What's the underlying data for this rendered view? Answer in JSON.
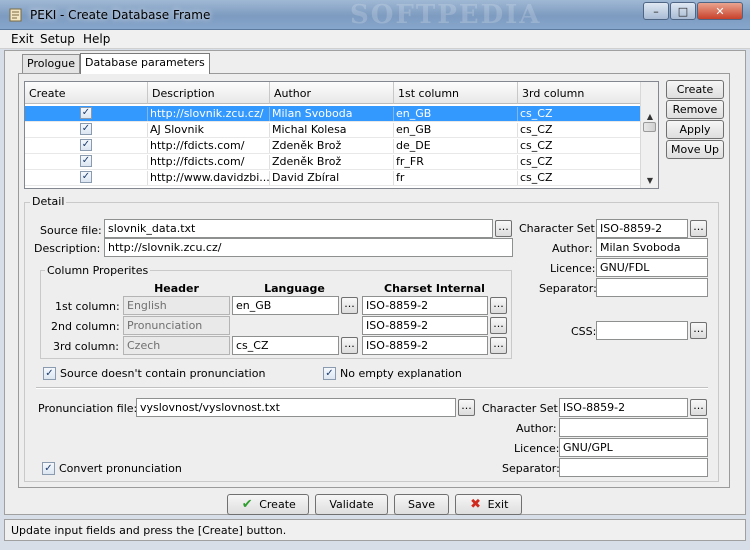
{
  "window": {
    "title": "PEKI - Create Database Frame",
    "watermark": "SOFTPEDIA",
    "minimize_symbol": "–",
    "maximize_symbol": "□",
    "close_symbol": "✕"
  },
  "menu": {
    "items": [
      "Exit",
      "Setup",
      "Help"
    ]
  },
  "tabs": [
    {
      "label": "Prologue",
      "active": false
    },
    {
      "label": "Database parameters",
      "active": true
    }
  ],
  "table": {
    "headers": [
      "Create",
      "Description",
      "Author",
      "1st column",
      "3rd column"
    ],
    "rows": [
      {
        "create": true,
        "description": "http://slovnik.zcu.cz/",
        "author": "Milan Svoboda",
        "col1": "en_GB",
        "col3": "cs_CZ",
        "selected": true
      },
      {
        "create": true,
        "description": "AJ Slovnik",
        "author": "Michal Kolesa",
        "col1": "en_GB",
        "col3": "cs_CZ",
        "selected": false
      },
      {
        "create": true,
        "description": "http://fdicts.com/",
        "author": "Zdeněk Brož",
        "col1": "de_DE",
        "col3": "cs_CZ",
        "selected": false
      },
      {
        "create": true,
        "description": "http://fdicts.com/",
        "author": "Zdeněk Brož",
        "col1": "fr_FR",
        "col3": "cs_CZ",
        "selected": false
      },
      {
        "create": true,
        "description": "http://www.davidzbi...",
        "author": "David Zbíral",
        "col1": "fr",
        "col3": "cs_CZ",
        "selected": false
      }
    ],
    "check_mark": "✓"
  },
  "side_buttons": {
    "create": "Create",
    "remove": "Remove",
    "apply": "Apply",
    "move_up": "Move Up"
  },
  "detail": {
    "legend": "Detail",
    "source_file_label": "Source file:",
    "source_file_value": "slovnik_data.txt",
    "description_label": "Description:",
    "description_value": "http://slovnik.zcu.cz/",
    "charset_label": "Character Set:",
    "charset_value": "ISO-8859-2",
    "author_label": "Author:",
    "author_value": "Milan Svoboda",
    "licence_label": "Licence:",
    "licence_value": "GNU/FDL",
    "separator_label": "Separator:",
    "separator_value": "",
    "css_label": "CSS:",
    "css_value": "",
    "browse": "..."
  },
  "columns": {
    "legend": "Column Properites",
    "headers": {
      "header": "Header",
      "language": "Language",
      "charset": "Charset Internal"
    },
    "rows": [
      {
        "label": "1st column:",
        "header": "English",
        "language": "en_GB",
        "charset": "ISO-8859-2"
      },
      {
        "label": "2nd column:",
        "header": "Pronunciation",
        "language": "",
        "charset": "ISO-8859-2"
      },
      {
        "label": "3rd column:",
        "header": "Czech",
        "language": "cs_CZ",
        "charset": "ISO-8859-2"
      }
    ]
  },
  "options": {
    "no_pronunciation": "Source doesn't contain pronunciation",
    "no_empty": "No empty explanation",
    "convert": "Convert pronunciation"
  },
  "pronunciation": {
    "file_label": "Pronunciation file:",
    "file_value": "vyslovnost/vyslovnost.txt",
    "charset_label": "Character Set:",
    "charset_value": "ISO-8859-2",
    "author_label": "Author:",
    "author_value": "",
    "licence_label": "Licence:",
    "licence_value": "GNU/GPL",
    "separator_label": "Separator:",
    "separator_value": ""
  },
  "bottom_buttons": {
    "create": "Create",
    "validate": "Validate",
    "save": "Save",
    "exit": "Exit"
  },
  "status": "Update input fields and press the [Create] button.",
  "colors": {
    "selection": "#3399ff",
    "create_icon": "#2e9e2e",
    "exit_icon": "#d02a1e"
  }
}
